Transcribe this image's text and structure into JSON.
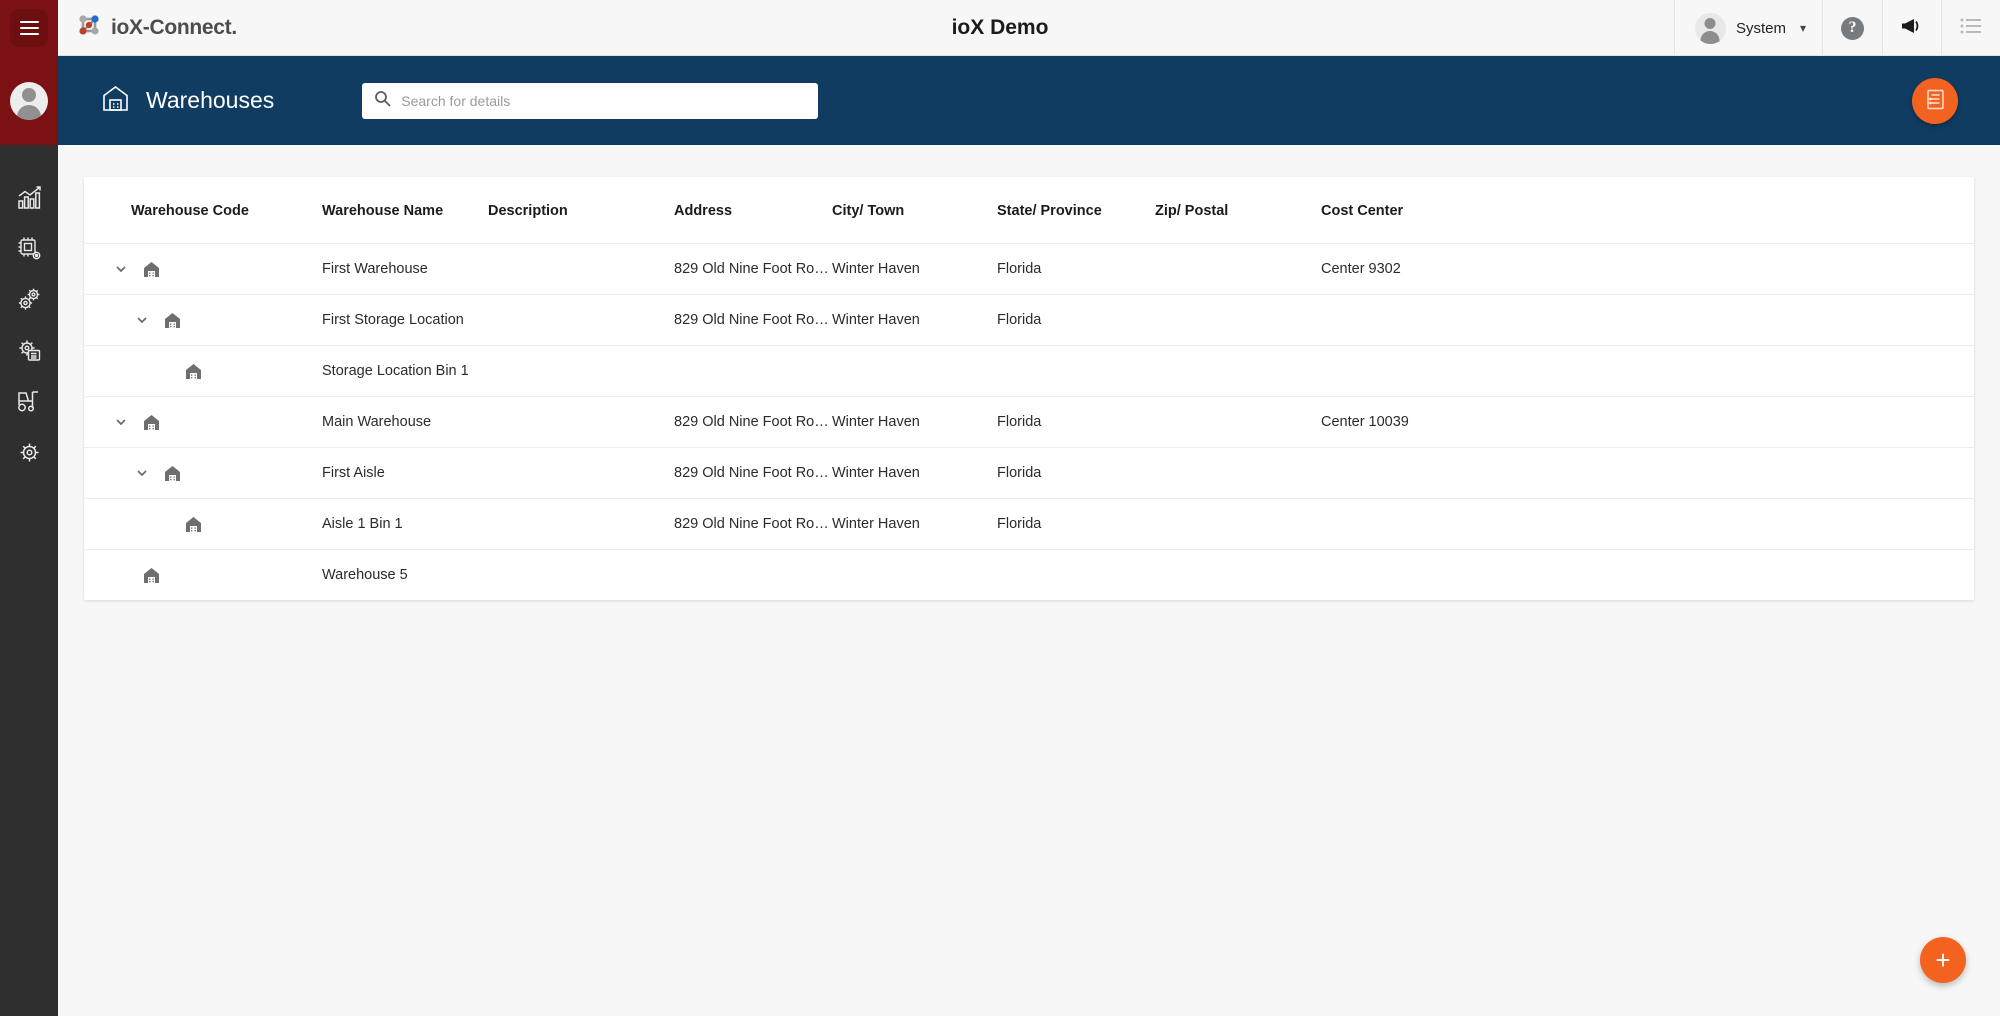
{
  "topbar": {
    "menu_icon": "hamburger-icon",
    "brand": "ioX-Connect.",
    "brand_logo_icon": "iox-network-logo-icon",
    "app_title": "ioX Demo",
    "user_name": "System",
    "user_caret_icon": "chevron-down-icon",
    "avatar_icon": "user-avatar-icon",
    "help_icon": "help-circle-icon",
    "help_glyph": "?",
    "announce_icon": "megaphone-icon",
    "list_icon": "list-menu-icon"
  },
  "rail": {
    "avatar_icon": "user-avatar-icon",
    "items": [
      {
        "icon": "analytics-bar-chart-icon",
        "name": "sidebar-item-analytics"
      },
      {
        "icon": "device-chip-icon",
        "name": "sidebar-item-devices"
      },
      {
        "icon": "gears-icon",
        "name": "sidebar-item-operations"
      },
      {
        "icon": "gear-panel-icon",
        "name": "sidebar-item-configuration"
      },
      {
        "icon": "forklift-icon",
        "name": "sidebar-item-warehouse"
      },
      {
        "icon": "gear-icon",
        "name": "sidebar-item-settings"
      }
    ]
  },
  "subheader": {
    "page_icon": "warehouse-icon",
    "page_title": "Warehouses",
    "search_placeholder": "Search for details",
    "search_value": "",
    "search_icon": "search-icon",
    "report_button_icon": "report-document-icon"
  },
  "table": {
    "columns": [
      "Warehouse Code",
      "Warehouse Name",
      "Description",
      "Address",
      "City/ Town",
      "State/ Province",
      "Zip/ Postal",
      "Cost Center"
    ],
    "rows": [
      {
        "level": 0,
        "expandable": true,
        "expanded": true,
        "code": "",
        "name": "First Warehouse",
        "description": "",
        "address": "829 Old Nine Foot Roa...",
        "city": "Winter Haven",
        "state": "Florida",
        "zip": "",
        "cost_center": "Center 9302"
      },
      {
        "level": 1,
        "expandable": true,
        "expanded": true,
        "code": "",
        "name": "First Storage Location",
        "description": "",
        "address": "829 Old Nine Foot Roa...",
        "city": "Winter Haven",
        "state": "Florida",
        "zip": "",
        "cost_center": ""
      },
      {
        "level": 2,
        "expandable": false,
        "expanded": false,
        "code": "",
        "name": "Storage Location Bin 1",
        "description": "",
        "address": "",
        "city": "",
        "state": "",
        "zip": "",
        "cost_center": ""
      },
      {
        "level": 0,
        "expandable": true,
        "expanded": true,
        "code": "",
        "name": "Main Warehouse",
        "description": "",
        "address": "829 Old Nine Foot Roa...",
        "city": "Winter Haven",
        "state": "Florida",
        "zip": "",
        "cost_center": "Center 10039"
      },
      {
        "level": 1,
        "expandable": true,
        "expanded": true,
        "code": "",
        "name": "First Aisle",
        "description": "",
        "address": "829 Old Nine Foot Roa...",
        "city": "Winter Haven",
        "state": "Florida",
        "zip": "",
        "cost_center": ""
      },
      {
        "level": 2,
        "expandable": false,
        "expanded": false,
        "code": "",
        "name": "Aisle 1 Bin 1",
        "description": "",
        "address": "829 Old Nine Foot Roa...",
        "city": "Winter Haven",
        "state": "Florida",
        "zip": "",
        "cost_center": ""
      },
      {
        "level": 0,
        "expandable": false,
        "expanded": false,
        "code": "",
        "name": "Warehouse 5",
        "description": "",
        "address": "",
        "city": "",
        "state": "",
        "zip": "",
        "cost_center": ""
      }
    ],
    "row_icon": "warehouse-icon",
    "expand_icon": "chevron-down-icon"
  },
  "fab": {
    "add_icon": "plus-icon",
    "add_glyph": "+"
  },
  "colors": {
    "brand_maroon": "#7b1113",
    "header_blue": "#103c61",
    "accent_orange": "#f26322",
    "rail_dark": "#2f2f2f"
  }
}
